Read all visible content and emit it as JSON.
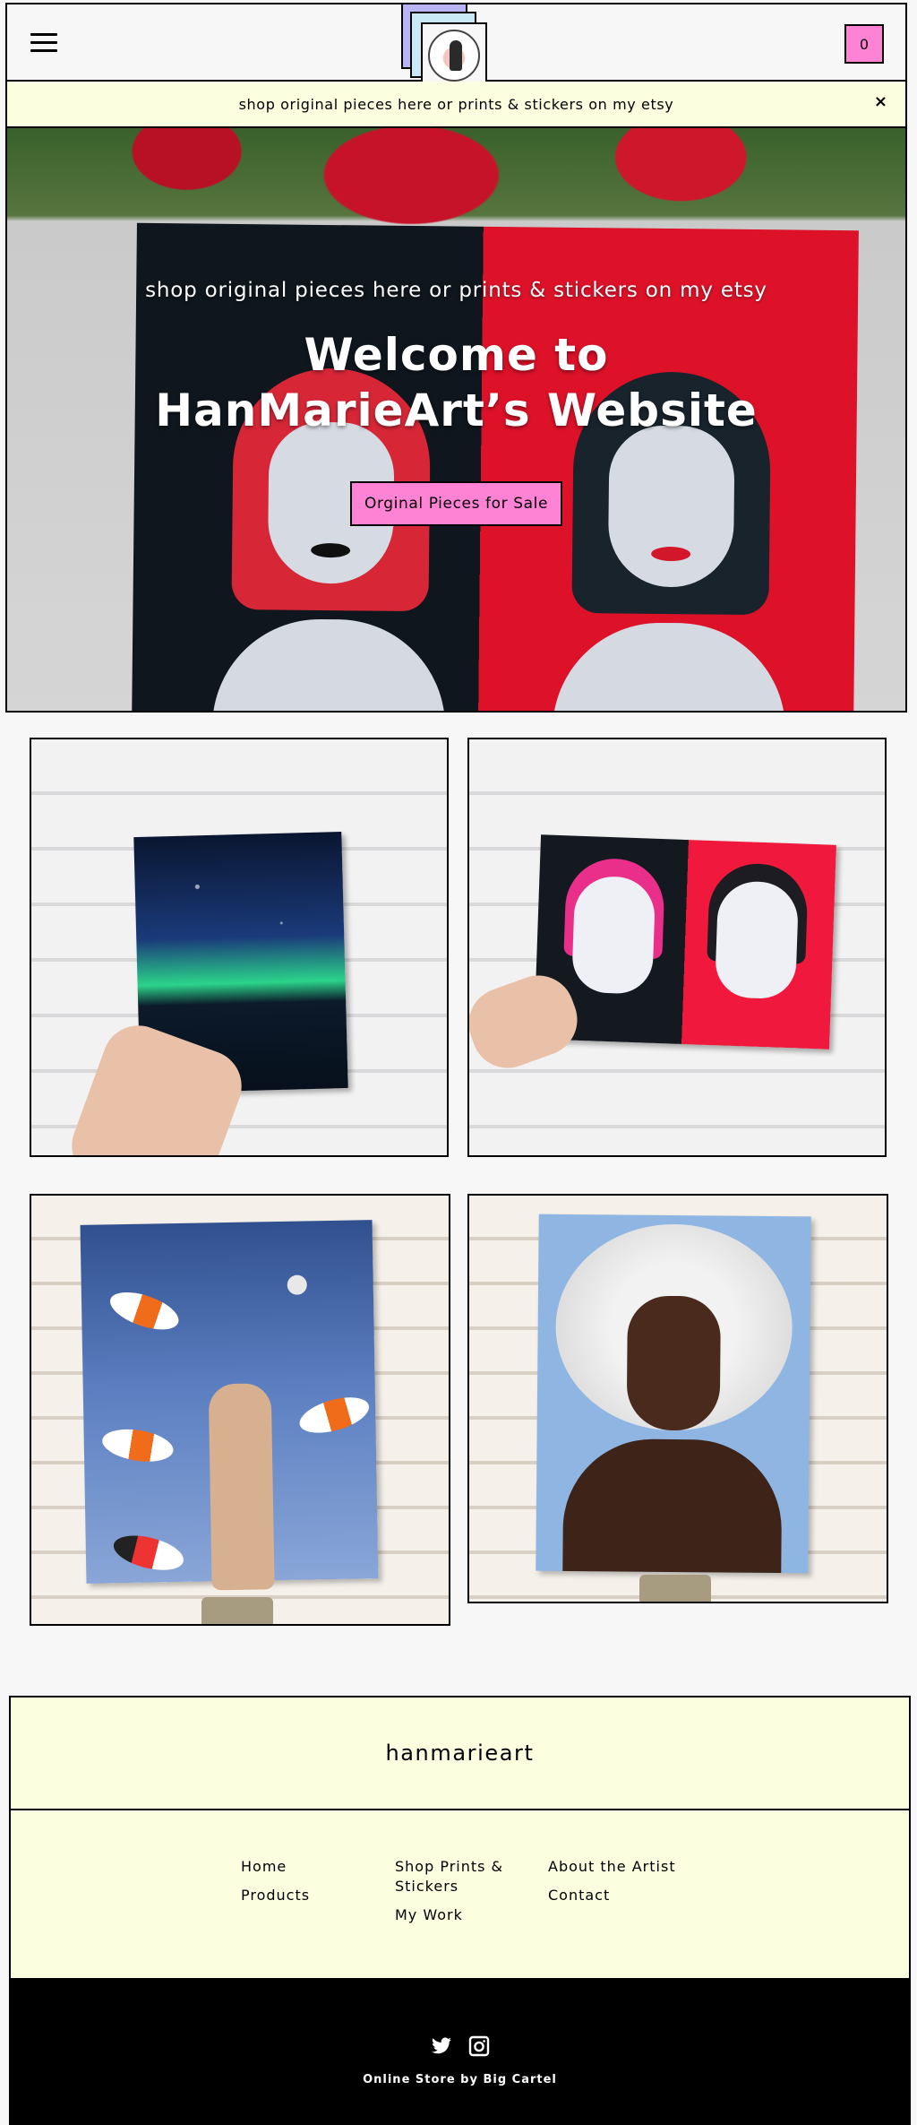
{
  "header": {
    "cart_count": "0",
    "colors": {
      "accent": "#ff83d5",
      "banner_bg": "#fbffe0",
      "border": "#000000"
    }
  },
  "banner": {
    "text": "shop original pieces here or prints & stickers on my etsy",
    "close": "×"
  },
  "hero": {
    "subtitle": "shop original pieces here or prints & stickers on my etsy",
    "title": "Welcome to HanMarieArt’s Website",
    "button_label": "Orginal Pieces for Sale"
  },
  "products": [
    {
      "artwork": "galaxy-painting"
    },
    {
      "artwork": "devil-girls-painting"
    },
    {
      "artwork": "koi-fish-painting"
    },
    {
      "artwork": "afro-portrait-painting"
    }
  ],
  "footer": {
    "brand": "hanmarieart",
    "nav": {
      "col1": [
        "Home",
        "Products"
      ],
      "col2": [
        "Shop Prints & Stickers",
        "My Work"
      ],
      "col3": [
        "About the Artist",
        "Contact"
      ]
    },
    "social_icons": [
      "twitter-icon",
      "instagram-icon"
    ],
    "credit": "Online Store by Big Cartel"
  }
}
